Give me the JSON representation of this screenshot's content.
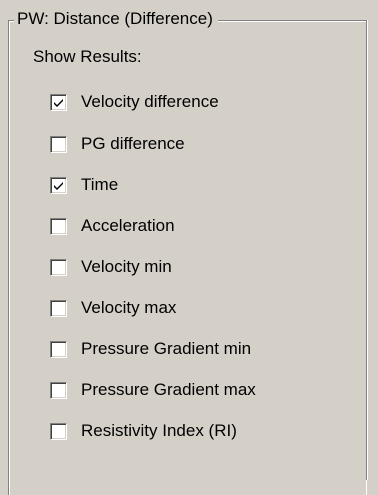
{
  "group": {
    "title": "PW: Distance (Difference)",
    "subtitle": "Show Results:"
  },
  "options": [
    {
      "label": "Velocity difference",
      "checked": true
    },
    {
      "label": "PG difference",
      "checked": false
    },
    {
      "label": "Time",
      "checked": true
    },
    {
      "label": "Acceleration",
      "checked": false
    },
    {
      "label": "Velocity min",
      "checked": false
    },
    {
      "label": "Velocity max",
      "checked": false
    },
    {
      "label": "Pressure Gradient min",
      "checked": false
    },
    {
      "label": "Pressure Gradient max",
      "checked": false
    },
    {
      "label": "Resistivity Index (RI)",
      "checked": false
    }
  ]
}
